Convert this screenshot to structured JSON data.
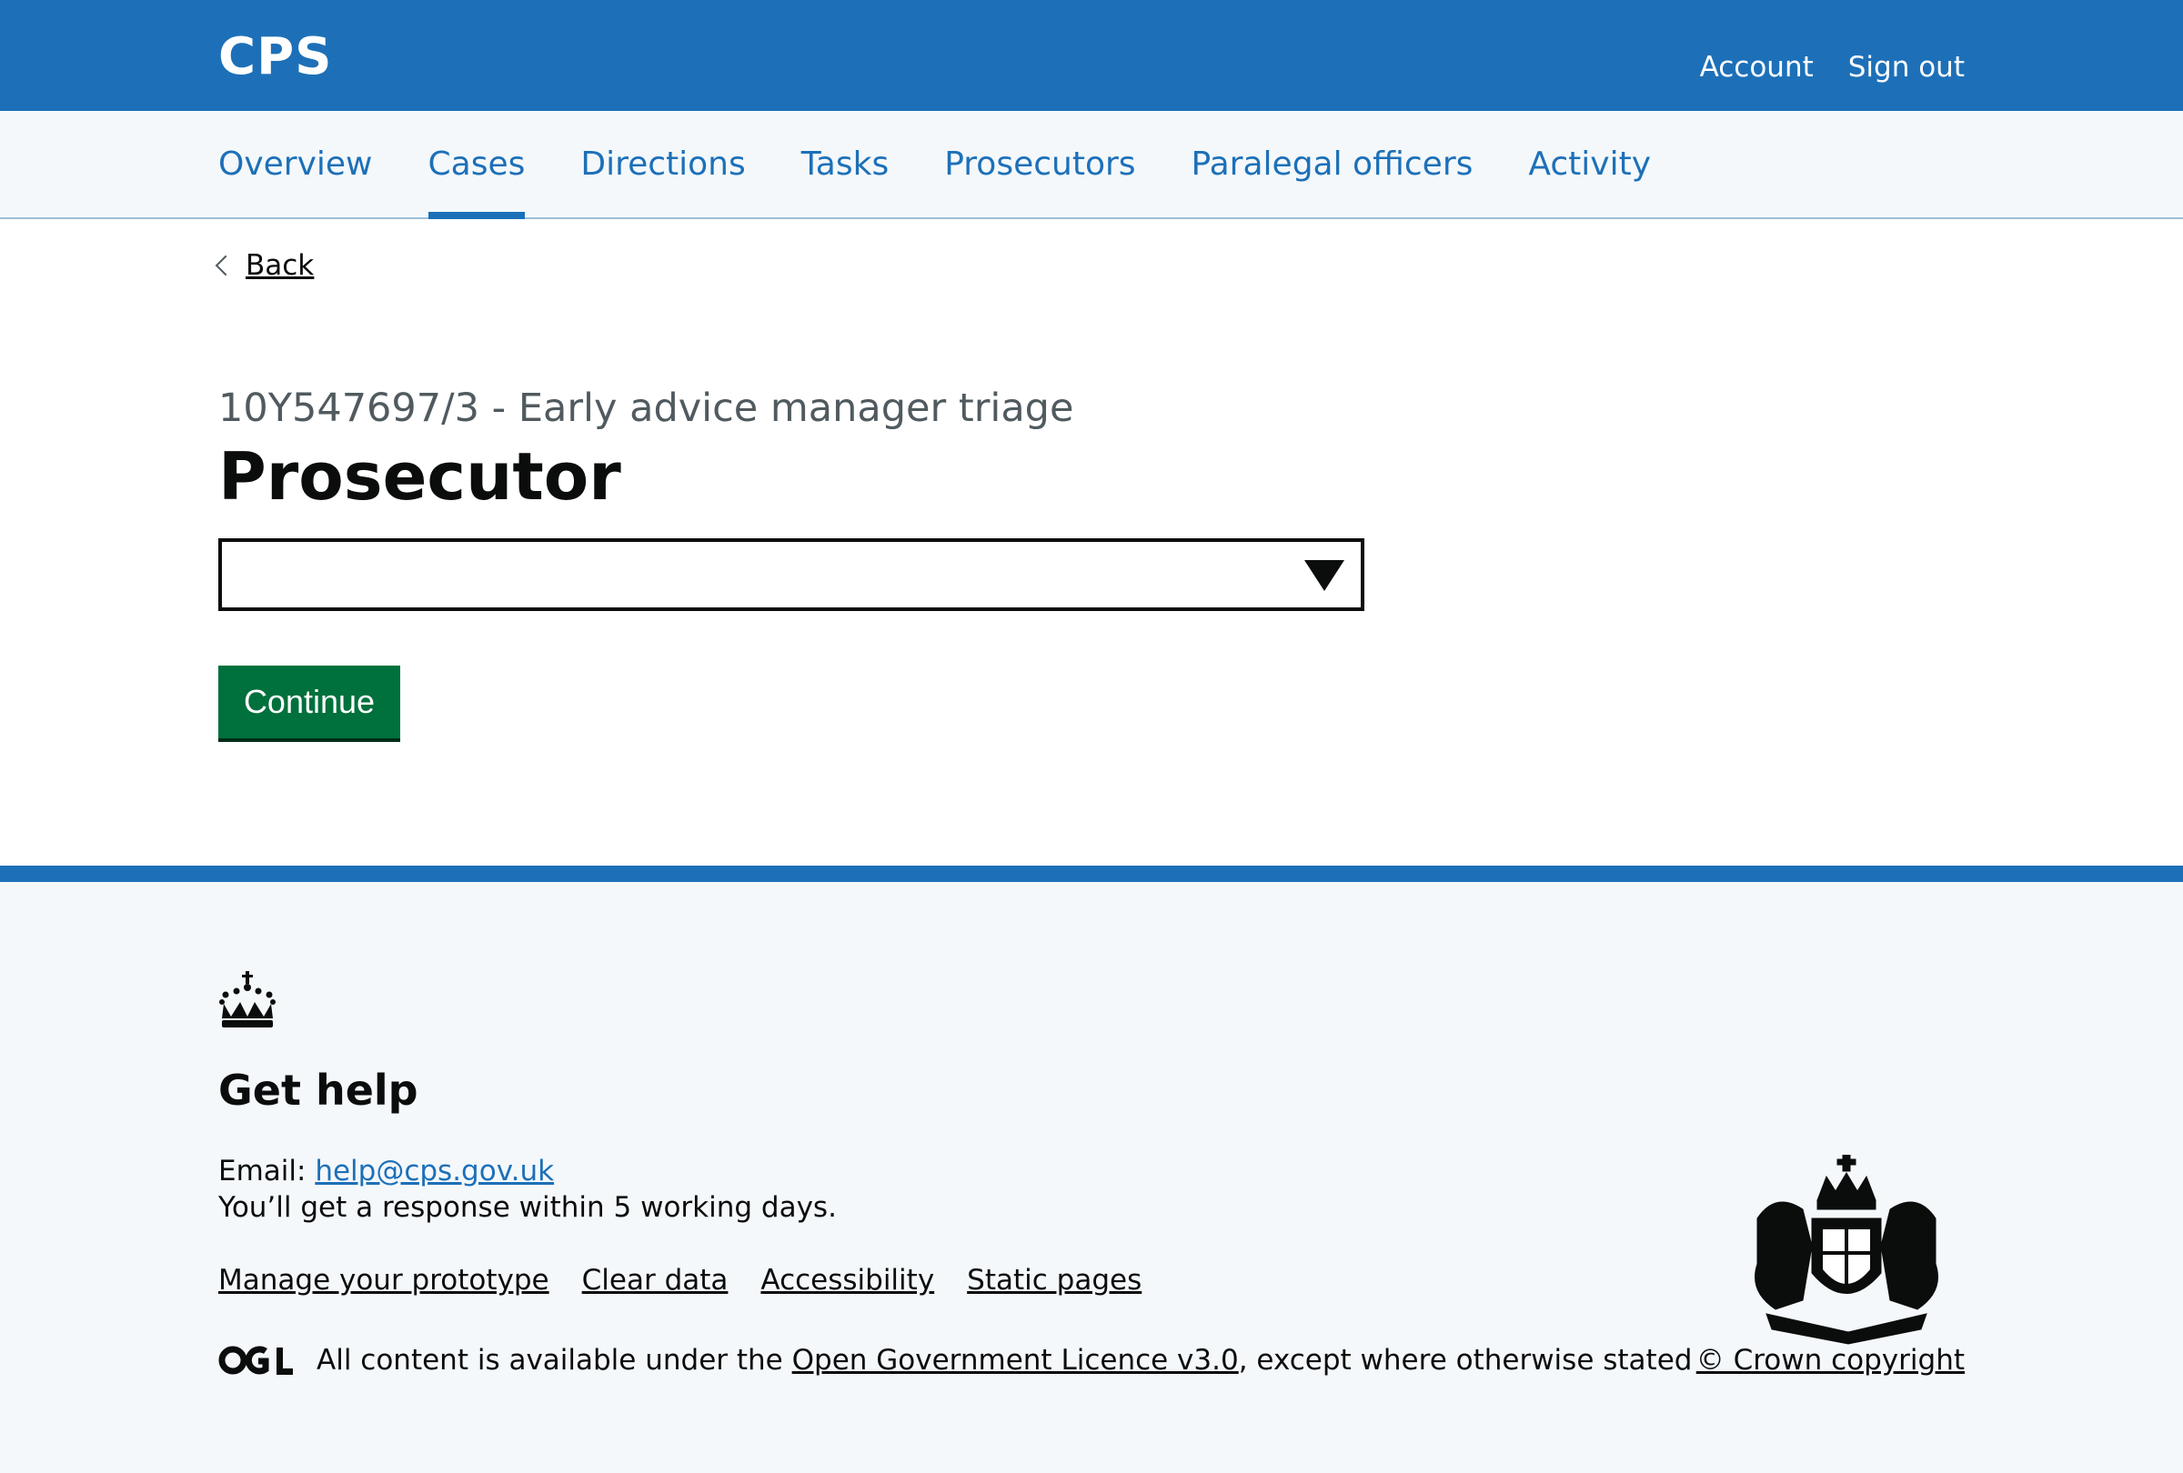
{
  "header": {
    "brand": "CPS",
    "account": "Account",
    "sign_out": "Sign out"
  },
  "nav": {
    "items": [
      {
        "label": "Overview",
        "active": false
      },
      {
        "label": "Cases",
        "active": true
      },
      {
        "label": "Directions",
        "active": false
      },
      {
        "label": "Tasks",
        "active": false
      },
      {
        "label": "Prosecutors",
        "active": false
      },
      {
        "label": "Paralegal officers",
        "active": false
      },
      {
        "label": "Activity",
        "active": false
      }
    ]
  },
  "back": {
    "label": "Back"
  },
  "main": {
    "caption": "10Y547697/3 - Early advice manager triage",
    "heading": "Prosecutor",
    "select_value": "",
    "continue_label": "Continue"
  },
  "footer": {
    "get_help": "Get help",
    "email_label": "Email:",
    "email": "help@cps.gov.uk",
    "response": "You’ll get a response within 5 working days.",
    "links": [
      "Manage your prototype",
      "Clear data",
      "Accessibility",
      "Static pages"
    ],
    "ogl_prefix": "All content is available under the",
    "ogl_link": "Open Government Licence v3.0",
    "ogl_suffix": ", except where otherwise stated",
    "copyright": "© Crown copyright"
  },
  "colors": {
    "brand_blue": "#1d70b8",
    "button_green": "#00703c",
    "footer_bg": "#f4f8fb"
  }
}
